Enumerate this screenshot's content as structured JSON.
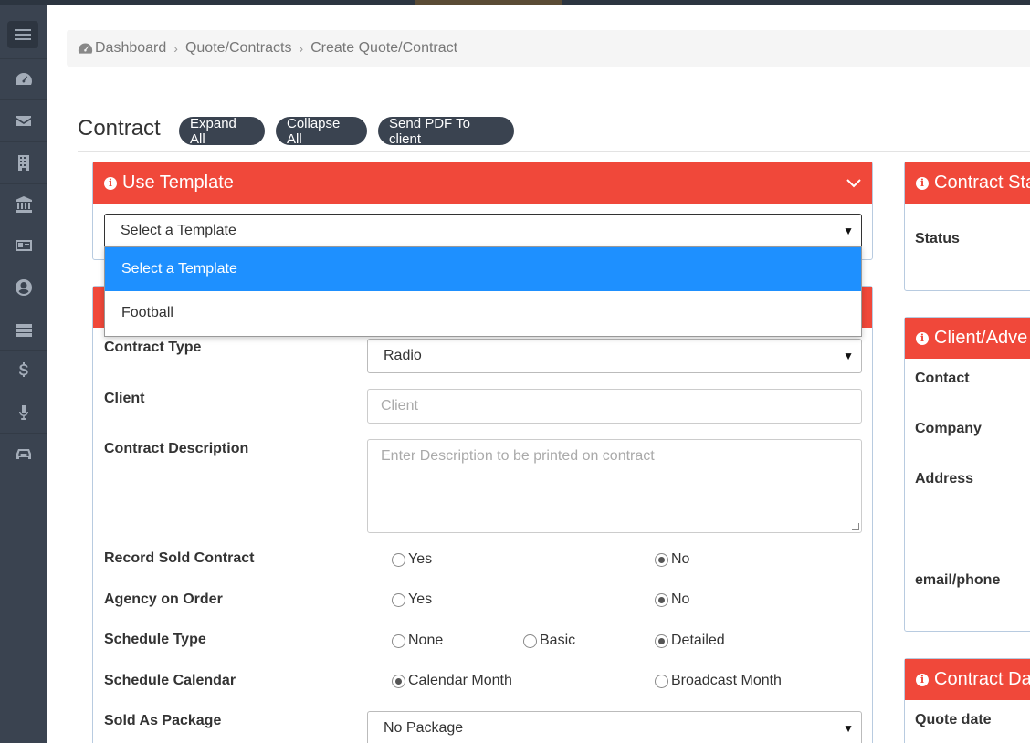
{
  "breadcrumb": {
    "home": "Dashboard",
    "level2": "Quote/Contracts",
    "current": "Create Quote/Contract"
  },
  "page": {
    "title": "Contract"
  },
  "toolbar": {
    "expand_all": "Expand All",
    "collapse_all": "Collapse All",
    "send_pdf": "Send PDF To client"
  },
  "template_panel": {
    "title": "Use Template",
    "selected": "Select a Template",
    "options": [
      "Select a Template",
      "Football"
    ]
  },
  "form": {
    "contract_type": {
      "label": "Contract Type",
      "value": "Radio"
    },
    "client": {
      "label": "Client",
      "placeholder": "Client"
    },
    "description": {
      "label": "Contract Description",
      "placeholder": "Enter Description to be printed on contract"
    },
    "record_sold": {
      "label": "Record Sold Contract",
      "yes": "Yes",
      "no": "No"
    },
    "agency_on_order": {
      "label": "Agency on Order",
      "yes": "Yes",
      "no": "No"
    },
    "schedule_type": {
      "label": "Schedule Type",
      "none": "None",
      "basic": "Basic",
      "detailed": "Detailed"
    },
    "schedule_calendar": {
      "label": "Schedule Calendar",
      "calendar_month": "Calendar Month",
      "broadcast_month": "Broadcast Month"
    },
    "sold_as_package": {
      "label": "Sold As Package",
      "value": "No Package"
    }
  },
  "right_panels": {
    "status": {
      "title": "Contract Sta",
      "status_label": "Status"
    },
    "client": {
      "title": "Client/Adve",
      "contact": "Contact",
      "company": "Company",
      "address": "Address",
      "email_phone": "email/phone"
    },
    "dates": {
      "title": "Contract Da",
      "quote_date": "Quote date"
    }
  },
  "colors": {
    "panel_header": "#f0483a",
    "sidebar": "#3a4350",
    "selection": "#1e90ff"
  },
  "sidebar": {
    "icons": [
      "menu-icon",
      "dashboard-icon",
      "envelope-icon",
      "building-icon",
      "bank-icon",
      "id-card-icon",
      "user-circle-icon",
      "server-icon",
      "dollar-icon",
      "microphone-icon",
      "car-icon"
    ]
  }
}
